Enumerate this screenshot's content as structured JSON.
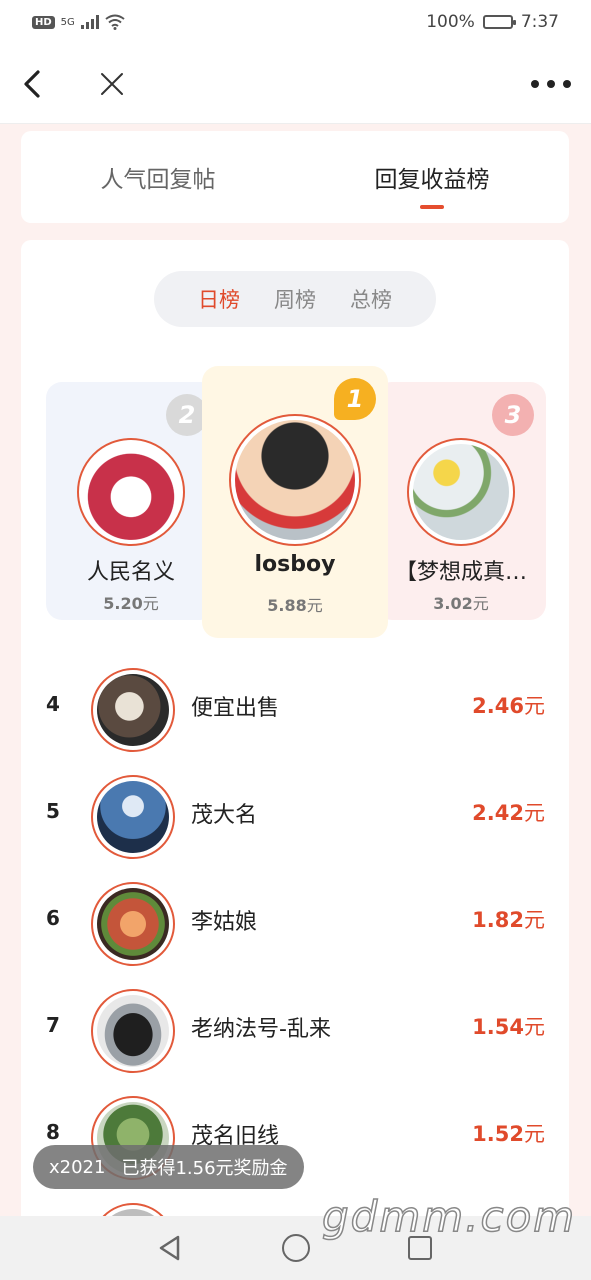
{
  "status_bar": {
    "network": "HD",
    "signal_gen": "5G",
    "battery": "100%",
    "time": "7:37"
  },
  "tabs": [
    {
      "label": "人气回复帖",
      "active": false
    },
    {
      "label": "回复收益榜",
      "active": true
    }
  ],
  "periods": [
    {
      "label": "日榜",
      "active": true
    },
    {
      "label": "周榜",
      "active": false
    },
    {
      "label": "总榜",
      "active": false
    }
  ],
  "podium": {
    "first": {
      "rank": "1",
      "name": "losboy",
      "amount": "5.88",
      "unit": "元"
    },
    "second": {
      "rank": "2",
      "name": "人民名义",
      "amount": "5.20",
      "unit": "元"
    },
    "third": {
      "rank": "3",
      "name": "【梦想成真…",
      "amount": "3.02",
      "unit": "元"
    }
  },
  "list": [
    {
      "rank": "4",
      "name": "便宜出售",
      "amount": "2.46",
      "unit": "元"
    },
    {
      "rank": "5",
      "name": "茂大名",
      "amount": "2.42",
      "unit": "元"
    },
    {
      "rank": "6",
      "name": "李姑娘",
      "amount": "1.82",
      "unit": "元"
    },
    {
      "rank": "7",
      "name": "老纳法号-乱来",
      "amount": "1.54",
      "unit": "元"
    },
    {
      "rank": "8",
      "name": "茂名旧线",
      "amount": "1.52",
      "unit": "元"
    }
  ],
  "toast": {
    "user": "x2021",
    "message": "已获得1.56元奖励金"
  },
  "watermark": "gdmm.com",
  "colors": {
    "accent": "#e04a2b",
    "gold": "#f6b021",
    "page_bg": "#fdf1ef"
  }
}
